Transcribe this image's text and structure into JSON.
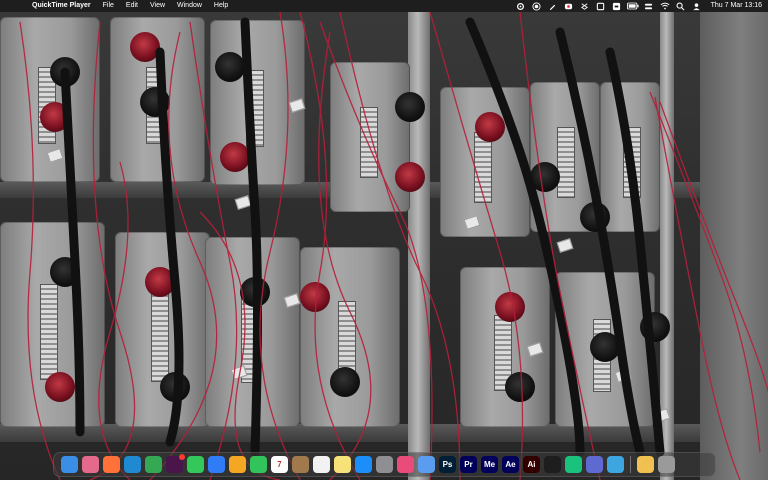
{
  "menubar": {
    "apple_icon": "apple-icon",
    "app_name": "QuickTime Player",
    "menus": [
      "File",
      "Edit",
      "View",
      "Window",
      "Help"
    ],
    "status_icons": [
      "settings-icon",
      "record-icon",
      "pen-icon",
      "extension-icon",
      "dropbox-icon",
      "square-icon",
      "input-source-icon",
      "battery-icon",
      "control-center-icon",
      "wifi-icon",
      "search-icon",
      "user-icon"
    ],
    "clock": "Thu 7 Mar  13:16"
  },
  "dock": {
    "apps": [
      {
        "name": "finder-icon",
        "color": "#3a8ee6",
        "label": ""
      },
      {
        "name": "launchpad-icon",
        "color": "#e36a8c",
        "label": ""
      },
      {
        "name": "firefox-icon",
        "color": "#ff7139",
        "label": ""
      },
      {
        "name": "vscode-icon",
        "color": "#1f8ad2",
        "label": ""
      },
      {
        "name": "chrome-icon",
        "color": "#34a853",
        "label": ""
      },
      {
        "name": "slack-icon",
        "color": "#4a154b",
        "label": "",
        "badge": true
      },
      {
        "name": "messages-icon",
        "color": "#34c759",
        "label": ""
      },
      {
        "name": "mail-icon",
        "color": "#2f7cf6",
        "label": ""
      },
      {
        "name": "photos-icon",
        "color": "#f5a623",
        "label": ""
      },
      {
        "name": "facetime-icon",
        "color": "#32c45a",
        "label": ""
      },
      {
        "name": "calendar-icon",
        "color": "#ffffff",
        "label": "7"
      },
      {
        "name": "notes-brown-icon",
        "color": "#a07a4c",
        "label": ""
      },
      {
        "name": "reminders-icon",
        "color": "#f2f2f2",
        "label": ""
      },
      {
        "name": "notes-icon",
        "color": "#f7e27a",
        "label": ""
      },
      {
        "name": "app-store-icon",
        "color": "#1c8ef9",
        "label": ""
      },
      {
        "name": "system-settings-icon",
        "color": "#8e8e93",
        "label": ""
      },
      {
        "name": "arc-icon",
        "color": "#e94b7a",
        "label": ""
      },
      {
        "name": "preview-icon",
        "color": "#5a9cf0",
        "label": ""
      },
      {
        "name": "photoshop-icon",
        "color": "#001e36",
        "label": "Ps"
      },
      {
        "name": "premiere-icon",
        "color": "#00005b",
        "label": "Pr"
      },
      {
        "name": "media-encoder-icon",
        "color": "#00005b",
        "label": "Me"
      },
      {
        "name": "after-effects-icon",
        "color": "#00005b",
        "label": "Ae"
      },
      {
        "name": "illustrator-icon",
        "color": "#330000",
        "label": "Ai"
      },
      {
        "name": "figma-icon",
        "color": "#1e1e1e",
        "label": ""
      },
      {
        "name": "chatgpt-icon",
        "color": "#19c37d",
        "label": ""
      },
      {
        "name": "linear-icon",
        "color": "#5e6ad2",
        "label": ""
      },
      {
        "name": "quicktime-icon",
        "color": "#3da5e0",
        "label": ""
      },
      {
        "name": "folder-icon",
        "color": "#f0c050",
        "label": ""
      },
      {
        "name": "trash-icon",
        "color": "#9a9a9a",
        "label": ""
      }
    ]
  }
}
